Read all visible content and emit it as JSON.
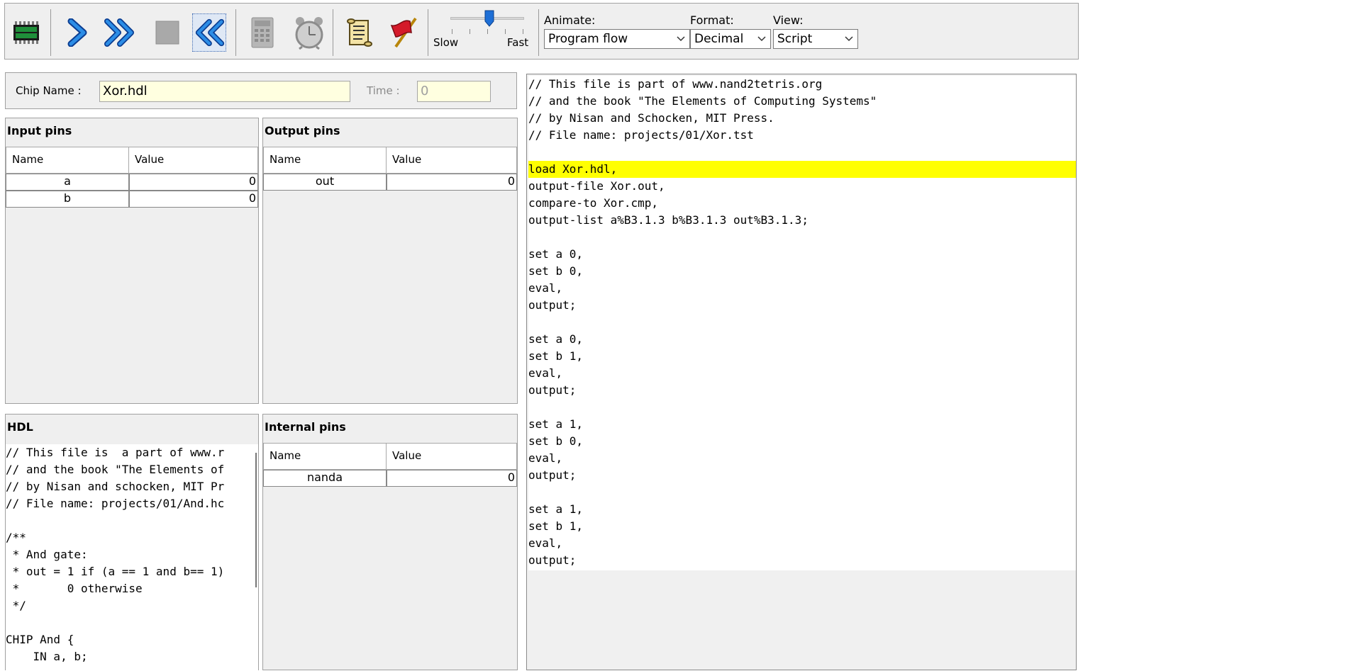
{
  "toolbar": {
    "animate_label": "Animate:",
    "animate_value": "Program flow",
    "format_label": "Format:",
    "format_value": "Decimal",
    "view_label": "View:",
    "view_value": "Script",
    "speed_slow": "Slow",
    "speed_fast": "Fast",
    "speed_level": 0.5
  },
  "chip": {
    "name_label": "Chip Name :",
    "name_value": "Xor.hdl",
    "time_label": "Time :",
    "time_value": "0"
  },
  "input_pins": {
    "title": "Input pins",
    "col_name": "Name",
    "col_value": "Value",
    "rows": [
      {
        "name": "a",
        "value": "0"
      },
      {
        "name": "b",
        "value": "0"
      }
    ]
  },
  "output_pins": {
    "title": "Output pins",
    "col_name": "Name",
    "col_value": "Value",
    "rows": [
      {
        "name": "out",
        "value": "0"
      }
    ]
  },
  "internal_pins": {
    "title": "Internal pins",
    "col_name": "Name",
    "col_value": "Value",
    "rows": [
      {
        "name": "nanda",
        "value": "0"
      }
    ]
  },
  "hdl": {
    "title": "HDL",
    "lines": [
      "// This file is  a part of www.r",
      "// and the book \"The Elements of",
      "// by Nisan and schocken, MIT Pr",
      "// File name: projects/01/And.hc",
      "",
      "/**",
      " * And gate:",
      " * out = 1 if (a == 1 and b== 1)",
      " *       0 otherwise",
      " */",
      "",
      "CHIP And {",
      "    IN a, b;"
    ]
  },
  "script": {
    "highlight_index": 5,
    "lines": [
      "// This file is part of www.nand2tetris.org",
      "// and the book \"The Elements of Computing Systems\"",
      "// by Nisan and Schocken, MIT Press.",
      "// File name: projects/01/Xor.tst",
      "",
      "load Xor.hdl,",
      "output-file Xor.out,",
      "compare-to Xor.cmp,",
      "output-list a%B3.1.3 b%B3.1.3 out%B3.1.3;",
      "",
      "set a 0,",
      "set b 0,",
      "eval,",
      "output;",
      "",
      "set a 0,",
      "set b 1,",
      "eval,",
      "output;",
      "",
      "set a 1,",
      "set b 0,",
      "eval,",
      "output;",
      "",
      "set a 1,",
      "set b 1,",
      "eval,",
      "output;"
    ]
  },
  "colors": {
    "highlight": "#ffff00",
    "chip_field_bg": "#ffffe0",
    "accent_blue": "#1e6fd6"
  }
}
